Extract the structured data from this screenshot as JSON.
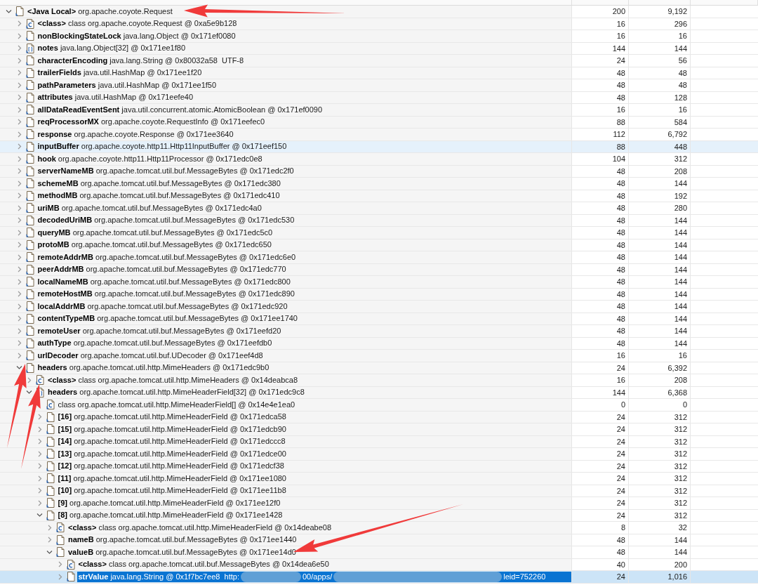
{
  "tree": [
    {
      "kind": "object",
      "name": "<Java Local>",
      "text": "org.apache.coyote.Request",
      "shallow_heap": "200",
      "retained_heap": "9,192",
      "expanded": true,
      "selected": false,
      "hovered": false,
      "children": [
        {
          "kind": "class",
          "name": "<class>",
          "text": "class org.apache.coyote.Request @ 0xa5e9b128",
          "shallow_heap": "16",
          "retained_heap": "296",
          "expanded": false,
          "selected": false,
          "hovered": false
        },
        {
          "kind": "object",
          "name": "nonBlockingStateLock",
          "text": "java.lang.Object @ 0x171ef0080",
          "shallow_heap": "16",
          "retained_heap": "16",
          "expanded": false,
          "selected": false,
          "hovered": false
        },
        {
          "kind": "array",
          "name": "notes",
          "text": "java.lang.Object[32] @ 0x171ee1f80",
          "shallow_heap": "144",
          "retained_heap": "144",
          "expanded": false,
          "selected": false,
          "hovered": false
        },
        {
          "kind": "object",
          "name": "characterEncoding",
          "text": "java.lang.String @ 0x80032a58  UTF-8",
          "shallow_heap": "24",
          "retained_heap": "56",
          "expanded": false,
          "selected": false,
          "hovered": false
        },
        {
          "kind": "object",
          "name": "trailerFields",
          "text": "java.util.HashMap @ 0x171ee1f20",
          "shallow_heap": "48",
          "retained_heap": "48",
          "expanded": false,
          "selected": false,
          "hovered": false
        },
        {
          "kind": "object",
          "name": "pathParameters",
          "text": "java.util.HashMap @ 0x171ee1f50",
          "shallow_heap": "48",
          "retained_heap": "48",
          "expanded": false,
          "selected": false,
          "hovered": false
        },
        {
          "kind": "object",
          "name": "attributes",
          "text": "java.util.HashMap @ 0x171eefe40",
          "shallow_heap": "48",
          "retained_heap": "128",
          "expanded": false,
          "selected": false,
          "hovered": false
        },
        {
          "kind": "object",
          "name": "allDataReadEventSent",
          "text": "java.util.concurrent.atomic.AtomicBoolean @ 0x171ef0090",
          "shallow_heap": "16",
          "retained_heap": "16",
          "expanded": false,
          "selected": false,
          "hovered": false
        },
        {
          "kind": "object",
          "name": "reqProcessorMX",
          "text": "org.apache.coyote.RequestInfo @ 0x171eefec0",
          "shallow_heap": "88",
          "retained_heap": "584",
          "expanded": false,
          "selected": false,
          "hovered": false
        },
        {
          "kind": "object",
          "name": "response",
          "text": "org.apache.coyote.Response @ 0x171ee3640",
          "shallow_heap": "112",
          "retained_heap": "6,792",
          "expanded": false,
          "selected": false,
          "hovered": false
        },
        {
          "kind": "object",
          "name": "inputBuffer",
          "text": "org.apache.coyote.http11.Http11InputBuffer @ 0x171eef150",
          "shallow_heap": "88",
          "retained_heap": "448",
          "expanded": false,
          "selected": false,
          "hovered": true
        },
        {
          "kind": "object",
          "name": "hook",
          "text": "org.apache.coyote.http11.Http11Processor @ 0x171edc0e8",
          "shallow_heap": "104",
          "retained_heap": "312",
          "expanded": false,
          "selected": false,
          "hovered": false
        },
        {
          "kind": "object",
          "name": "serverNameMB",
          "text": "org.apache.tomcat.util.buf.MessageBytes @ 0x171edc2f0",
          "shallow_heap": "48",
          "retained_heap": "208",
          "expanded": false,
          "selected": false,
          "hovered": false
        },
        {
          "kind": "object",
          "name": "schemeMB",
          "text": "org.apache.tomcat.util.buf.MessageBytes @ 0x171edc380",
          "shallow_heap": "48",
          "retained_heap": "144",
          "expanded": false,
          "selected": false,
          "hovered": false
        },
        {
          "kind": "object",
          "name": "methodMB",
          "text": "org.apache.tomcat.util.buf.MessageBytes @ 0x171edc410",
          "shallow_heap": "48",
          "retained_heap": "192",
          "expanded": false,
          "selected": false,
          "hovered": false
        },
        {
          "kind": "object",
          "name": "uriMB",
          "text": "org.apache.tomcat.util.buf.MessageBytes @ 0x171edc4a0",
          "shallow_heap": "48",
          "retained_heap": "280",
          "expanded": false,
          "selected": false,
          "hovered": false
        },
        {
          "kind": "object",
          "name": "decodedUriMB",
          "text": "org.apache.tomcat.util.buf.MessageBytes @ 0x171edc530",
          "shallow_heap": "48",
          "retained_heap": "144",
          "expanded": false,
          "selected": false,
          "hovered": false
        },
        {
          "kind": "object",
          "name": "queryMB",
          "text": "org.apache.tomcat.util.buf.MessageBytes @ 0x171edc5c0",
          "shallow_heap": "48",
          "retained_heap": "144",
          "expanded": false,
          "selected": false,
          "hovered": false
        },
        {
          "kind": "object",
          "name": "protoMB",
          "text": "org.apache.tomcat.util.buf.MessageBytes @ 0x171edc650",
          "shallow_heap": "48",
          "retained_heap": "144",
          "expanded": false,
          "selected": false,
          "hovered": false
        },
        {
          "kind": "object",
          "name": "remoteAddrMB",
          "text": "org.apache.tomcat.util.buf.MessageBytes @ 0x171edc6e0",
          "shallow_heap": "48",
          "retained_heap": "144",
          "expanded": false,
          "selected": false,
          "hovered": false
        },
        {
          "kind": "object",
          "name": "peerAddrMB",
          "text": "org.apache.tomcat.util.buf.MessageBytes @ 0x171edc770",
          "shallow_heap": "48",
          "retained_heap": "144",
          "expanded": false,
          "selected": false,
          "hovered": false
        },
        {
          "kind": "object",
          "name": "localNameMB",
          "text": "org.apache.tomcat.util.buf.MessageBytes @ 0x171edc800",
          "shallow_heap": "48",
          "retained_heap": "144",
          "expanded": false,
          "selected": false,
          "hovered": false
        },
        {
          "kind": "object",
          "name": "remoteHostMB",
          "text": "org.apache.tomcat.util.buf.MessageBytes @ 0x171edc890",
          "shallow_heap": "48",
          "retained_heap": "144",
          "expanded": false,
          "selected": false,
          "hovered": false
        },
        {
          "kind": "object",
          "name": "localAddrMB",
          "text": "org.apache.tomcat.util.buf.MessageBytes @ 0x171edc920",
          "shallow_heap": "48",
          "retained_heap": "144",
          "expanded": false,
          "selected": false,
          "hovered": false
        },
        {
          "kind": "object",
          "name": "contentTypeMB",
          "text": "org.apache.tomcat.util.buf.MessageBytes @ 0x171ee1740",
          "shallow_heap": "48",
          "retained_heap": "144",
          "expanded": false,
          "selected": false,
          "hovered": false
        },
        {
          "kind": "object",
          "name": "remoteUser",
          "text": "org.apache.tomcat.util.buf.MessageBytes @ 0x171eefd20",
          "shallow_heap": "48",
          "retained_heap": "144",
          "expanded": false,
          "selected": false,
          "hovered": false
        },
        {
          "kind": "object",
          "name": "authType",
          "text": "org.apache.tomcat.util.buf.MessageBytes @ 0x171eefdb0",
          "shallow_heap": "48",
          "retained_heap": "144",
          "expanded": false,
          "selected": false,
          "hovered": false
        },
        {
          "kind": "object",
          "name": "urlDecoder",
          "text": "org.apache.tomcat.util.buf.UDecoder @ 0x171eef4d8",
          "shallow_heap": "16",
          "retained_heap": "16",
          "expanded": false,
          "selected": false,
          "hovered": false
        },
        {
          "kind": "object",
          "name": "headers",
          "text": "org.apache.tomcat.util.http.MimeHeaders @ 0x171edc9b0",
          "shallow_heap": "24",
          "retained_heap": "6,392",
          "expanded": true,
          "selected": false,
          "hovered": false,
          "children": [
            {
              "kind": "class",
              "name": "<class>",
              "text": "class org.apache.tomcat.util.http.MimeHeaders @ 0x14deabca8",
              "shallow_heap": "16",
              "retained_heap": "208",
              "expanded": false,
              "selected": false,
              "hovered": false
            },
            {
              "kind": "array",
              "name": "headers",
              "text": "org.apache.tomcat.util.http.MimeHeaderField[32] @ 0x171edc9c8",
              "shallow_heap": "144",
              "retained_heap": "6,368",
              "expanded": true,
              "selected": false,
              "hovered": false,
              "children": [
                {
                  "kind": "class",
                  "text": "class org.apache.tomcat.util.http.MimeHeaderField[] @ 0x14e4e1ea0",
                  "shallow_heap": "0",
                  "retained_heap": "0",
                  "selected": false,
                  "hovered": false
                },
                {
                  "kind": "object",
                  "name": "[16]",
                  "text": "org.apache.tomcat.util.http.MimeHeaderField @ 0x171edca58",
                  "shallow_heap": "24",
                  "retained_heap": "312",
                  "expanded": false,
                  "selected": false,
                  "hovered": false
                },
                {
                  "kind": "object",
                  "name": "[15]",
                  "text": "org.apache.tomcat.util.http.MimeHeaderField @ 0x171edcb90",
                  "shallow_heap": "24",
                  "retained_heap": "312",
                  "expanded": false,
                  "selected": false,
                  "hovered": false
                },
                {
                  "kind": "object",
                  "name": "[14]",
                  "text": "org.apache.tomcat.util.http.MimeHeaderField @ 0x171edccc8",
                  "shallow_heap": "24",
                  "retained_heap": "312",
                  "expanded": false,
                  "selected": false,
                  "hovered": false
                },
                {
                  "kind": "object",
                  "name": "[13]",
                  "text": "org.apache.tomcat.util.http.MimeHeaderField @ 0x171edce00",
                  "shallow_heap": "24",
                  "retained_heap": "312",
                  "expanded": false,
                  "selected": false,
                  "hovered": false
                },
                {
                  "kind": "object",
                  "name": "[12]",
                  "text": "org.apache.tomcat.util.http.MimeHeaderField @ 0x171edcf38",
                  "shallow_heap": "24",
                  "retained_heap": "312",
                  "expanded": false,
                  "selected": false,
                  "hovered": false
                },
                {
                  "kind": "object",
                  "name": "[11]",
                  "text": "org.apache.tomcat.util.http.MimeHeaderField @ 0x171ee1080",
                  "shallow_heap": "24",
                  "retained_heap": "312",
                  "expanded": false,
                  "selected": false,
                  "hovered": false
                },
                {
                  "kind": "object",
                  "name": "[10]",
                  "text": "org.apache.tomcat.util.http.MimeHeaderField @ 0x171ee11b8",
                  "shallow_heap": "24",
                  "retained_heap": "312",
                  "expanded": false,
                  "selected": false,
                  "hovered": false
                },
                {
                  "kind": "object",
                  "name": "[9]",
                  "text": "org.apache.tomcat.util.http.MimeHeaderField @ 0x171ee12f0",
                  "shallow_heap": "24",
                  "retained_heap": "312",
                  "expanded": false,
                  "selected": false,
                  "hovered": false
                },
                {
                  "kind": "object",
                  "name": "[8]",
                  "text": "org.apache.tomcat.util.http.MimeHeaderField @ 0x171ee1428",
                  "shallow_heap": "24",
                  "retained_heap": "312",
                  "expanded": true,
                  "selected": false,
                  "hovered": false,
                  "children": [
                    {
                      "kind": "class",
                      "name": "<class>",
                      "text": "class org.apache.tomcat.util.http.MimeHeaderField @ 0x14deabe08",
                      "shallow_heap": "8",
                      "retained_heap": "32",
                      "expanded": false,
                      "selected": false,
                      "hovered": false
                    },
                    {
                      "kind": "object",
                      "name": "nameB",
                      "text": "org.apache.tomcat.util.buf.MessageBytes @ 0x171ee1440",
                      "shallow_heap": "48",
                      "retained_heap": "144",
                      "expanded": false,
                      "selected": false,
                      "hovered": false
                    },
                    {
                      "kind": "object",
                      "name": "valueB",
                      "text": "org.apache.tomcat.util.buf.MessageBytes @ 0x171ee14d0",
                      "shallow_heap": "48",
                      "retained_heap": "144",
                      "expanded": true,
                      "selected": false,
                      "hovered": false,
                      "children": [
                        {
                          "kind": "class",
                          "name": "<class>",
                          "text": "class org.apache.tomcat.util.buf.MessageBytes @ 0x14dea6e50",
                          "shallow_heap": "40",
                          "retained_heap": "200",
                          "expanded": false,
                          "selected": false,
                          "hovered": false
                        },
                        {
                          "kind": "object",
                          "name": "strValue",
                          "text_parts": [
                            "java.lang.String @ 0x1f7bc7ee8  http:",
                            "00/apps/",
                            "leid=752260"
                          ],
                          "redacted": true,
                          "shallow_heap": "24",
                          "retained_heap": "1,016",
                          "expanded": false,
                          "selected": true,
                          "hovered": false
                        }
                      ]
                    }
                  ]
                }
              ]
            }
          ]
        }
      ]
    }
  ],
  "annotations": [
    {
      "kind": "arrow"
    },
    {
      "kind": "arrow"
    },
    {
      "kind": "arrow"
    },
    {
      "kind": "arrow"
    }
  ]
}
